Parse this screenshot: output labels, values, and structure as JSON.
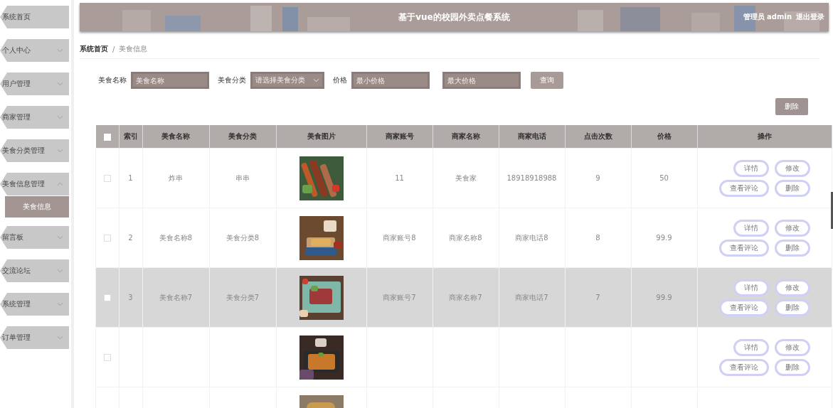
{
  "sidebar": {
    "items": [
      {
        "label": "系统首页",
        "kind": "link"
      },
      {
        "label": "个人中心",
        "kind": "menu",
        "expanded": false
      },
      {
        "label": "用户管理",
        "kind": "menu",
        "expanded": false
      },
      {
        "label": "商家管理",
        "kind": "menu",
        "expanded": false
      },
      {
        "label": "美食分类管理",
        "kind": "menu",
        "expanded": false
      },
      {
        "label": "美食信息管理",
        "kind": "menu",
        "expanded": true,
        "children": [
          {
            "label": "美食信息",
            "selected": true
          }
        ]
      },
      {
        "label": "留言板",
        "kind": "menu",
        "expanded": false
      },
      {
        "label": "交流论坛",
        "kind": "menu",
        "expanded": false
      },
      {
        "label": "系统管理",
        "kind": "menu",
        "expanded": false
      },
      {
        "label": "订单管理",
        "kind": "menu",
        "expanded": false
      }
    ]
  },
  "header": {
    "title": "基于vue的校园外卖点餐系统",
    "user": "管理员 admin",
    "logout": "退出登录"
  },
  "breadcrumb": {
    "items": [
      "系统首页",
      "美食信息"
    ],
    "separator": "/"
  },
  "search": {
    "fields": [
      {
        "label": "美食名称",
        "placeholder": "美食名称",
        "kind": "input"
      },
      {
        "label": "美食分类",
        "placeholder": "请选择美食分类",
        "kind": "select"
      },
      {
        "label": "价格",
        "placeholder": "最小价格",
        "kind": "input"
      },
      {
        "placeholder": "最大价格",
        "kind": "input"
      }
    ],
    "button": "查询"
  },
  "delete_button": "删除",
  "table": {
    "select_all": {
      "checked": false
    },
    "columns": [
      "索引",
      "美食名称",
      "美食分类",
      "美食图片",
      "商家账号",
      "商家名称",
      "商家电话",
      "点击次数",
      "价格",
      "操作"
    ],
    "rows": [
      {
        "checked": false,
        "highlighted": false,
        "cells": [
          "1",
          "炸串",
          "串串",
          {
            "kind": "picture"
          },
          "11",
          "美食家",
          "18918918988",
          "9",
          "50"
        ],
        "actions": [
          "详情",
          "修改",
          "查看评论",
          "删除"
        ]
      },
      {
        "checked": false,
        "highlighted": false,
        "cells": [
          "2",
          "美食名称8",
          "美食分类8",
          {
            "kind": "picture"
          },
          "商家账号8",
          "商家名称8",
          "商家电话8",
          "8",
          "99.9"
        ],
        "actions": [
          "详情",
          "修改",
          "查看评论",
          "删除"
        ]
      },
      {
        "checked": false,
        "highlighted": true,
        "cells": [
          "3",
          "美食名称7",
          "美食分类7",
          {
            "kind": "picture"
          },
          "商家账号7",
          "商家名称7",
          "商家电话7",
          "7",
          "99.9"
        ],
        "actions": [
          "详情",
          "修改",
          "查看评论",
          "删除"
        ]
      },
      {
        "checked": false,
        "highlighted": false,
        "cells": [
          null,
          null,
          null,
          {
            "kind": "picture"
          },
          null,
          null,
          null,
          null,
          null
        ],
        "actions": [
          "详情",
          "修改",
          "查看评论",
          "删除"
        ]
      }
    ]
  }
}
